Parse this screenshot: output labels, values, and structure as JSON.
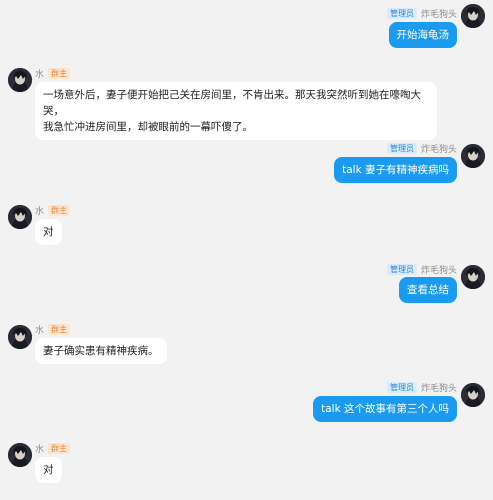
{
  "users": {
    "admin": {
      "name": "炸毛狗头",
      "badge": "管理员"
    },
    "owner": {
      "name": "水",
      "badge": "群主"
    }
  },
  "messages": [
    {
      "side": "right",
      "text": "开始海龟汤"
    },
    {
      "side": "left",
      "lines": [
        "一场意外后，妻子便开始把己关在房间里，不肯出来。那天我突然听到她在嚎啕大哭，",
        "我急忙冲进房间里，却被眼前的一幕吓傻了。"
      ]
    },
    {
      "side": "right",
      "text": "talk 妻子有精神疾病吗"
    },
    {
      "side": "left",
      "text": "对"
    },
    {
      "side": "right",
      "text": "查看总结"
    },
    {
      "side": "left",
      "text": "妻子确实患有精神疾病。"
    },
    {
      "side": "right",
      "text": "talk 这个故事有第三个人吗"
    },
    {
      "side": "left",
      "text": "对"
    }
  ],
  "colors": {
    "bubble_right": "#1a9bf0",
    "bubble_left": "#ffffff",
    "background": "#f2f2f2"
  }
}
